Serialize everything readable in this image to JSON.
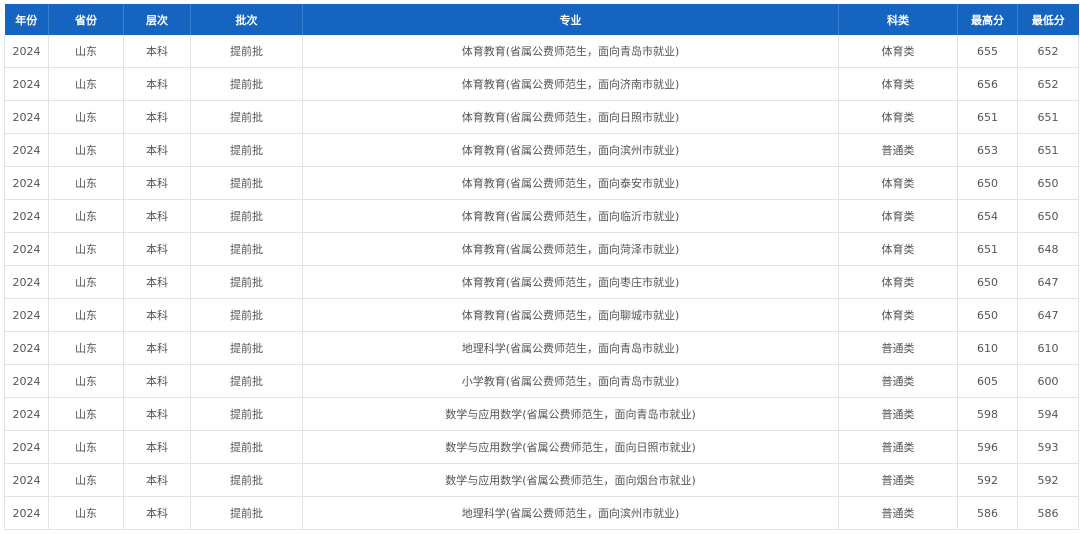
{
  "headers": [
    "年份",
    "省份",
    "层次",
    "批次",
    "专业",
    "科类",
    "最高分",
    "最低分"
  ],
  "rows": [
    [
      "2024",
      "山东",
      "本科",
      "提前批",
      "体育教育(省属公费师范生，面向青岛市就业)",
      "体育类",
      "655",
      "652"
    ],
    [
      "2024",
      "山东",
      "本科",
      "提前批",
      "体育教育(省属公费师范生，面向济南市就业)",
      "体育类",
      "656",
      "652"
    ],
    [
      "2024",
      "山东",
      "本科",
      "提前批",
      "体育教育(省属公费师范生，面向日照市就业)",
      "体育类",
      "651",
      "651"
    ],
    [
      "2024",
      "山东",
      "本科",
      "提前批",
      "体育教育(省属公费师范生，面向滨州市就业)",
      "普通类",
      "653",
      "651"
    ],
    [
      "2024",
      "山东",
      "本科",
      "提前批",
      "体育教育(省属公费师范生，面向泰安市就业)",
      "体育类",
      "650",
      "650"
    ],
    [
      "2024",
      "山东",
      "本科",
      "提前批",
      "体育教育(省属公费师范生，面向临沂市就业)",
      "体育类",
      "654",
      "650"
    ],
    [
      "2024",
      "山东",
      "本科",
      "提前批",
      "体育教育(省属公费师范生，面向菏泽市就业)",
      "体育类",
      "651",
      "648"
    ],
    [
      "2024",
      "山东",
      "本科",
      "提前批",
      "体育教育(省属公费师范生，面向枣庄市就业)",
      "体育类",
      "650",
      "647"
    ],
    [
      "2024",
      "山东",
      "本科",
      "提前批",
      "体育教育(省属公费师范生，面向聊城市就业)",
      "体育类",
      "650",
      "647"
    ],
    [
      "2024",
      "山东",
      "本科",
      "提前批",
      "地理科学(省属公费师范生，面向青岛市就业)",
      "普通类",
      "610",
      "610"
    ],
    [
      "2024",
      "山东",
      "本科",
      "提前批",
      "小学教育(省属公费师范生，面向青岛市就业)",
      "普通类",
      "605",
      "600"
    ],
    [
      "2024",
      "山东",
      "本科",
      "提前批",
      "数学与应用数学(省属公费师范生，面向青岛市就业)",
      "普通类",
      "598",
      "594"
    ],
    [
      "2024",
      "山东",
      "本科",
      "提前批",
      "数学与应用数学(省属公费师范生，面向日照市就业)",
      "普通类",
      "596",
      "593"
    ],
    [
      "2024",
      "山东",
      "本科",
      "提前批",
      "数学与应用数学(省属公费师范生，面向烟台市就业)",
      "普通类",
      "592",
      "592"
    ],
    [
      "2024",
      "山东",
      "本科",
      "提前批",
      "地理科学(省属公费师范生，面向滨州市就业)",
      "普通类",
      "586",
      "586"
    ]
  ]
}
